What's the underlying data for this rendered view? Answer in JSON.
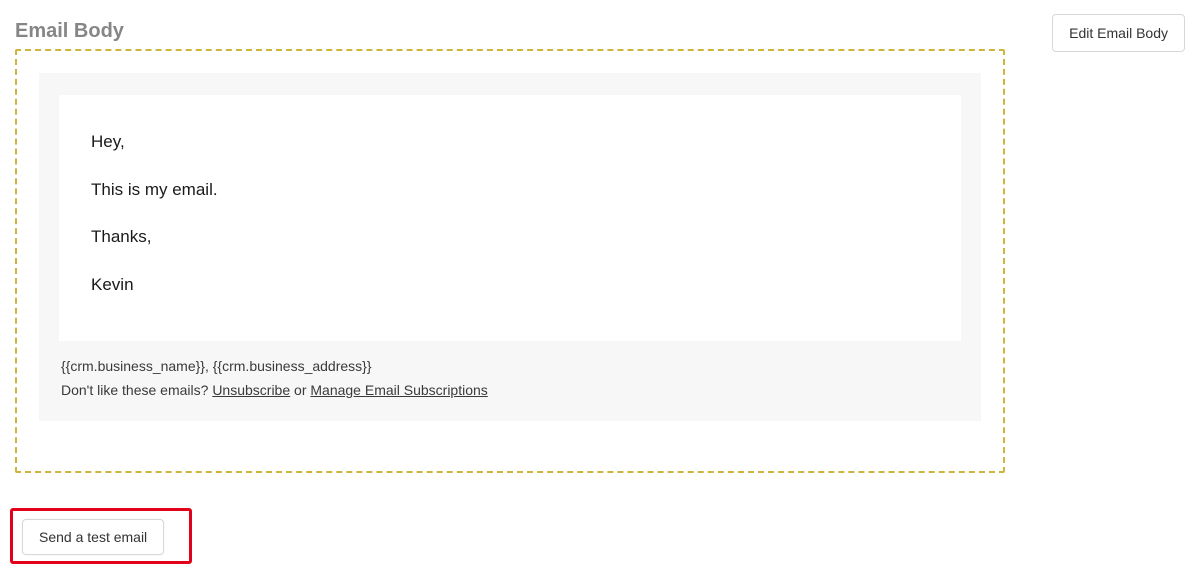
{
  "section": {
    "title": "Email Body"
  },
  "buttons": {
    "edit": "Edit Email Body",
    "sendTest": "Send a test email"
  },
  "email": {
    "greeting": "Hey,",
    "body": "This is my email.",
    "closing": "Thanks,",
    "signature": "Kevin"
  },
  "footer": {
    "placeholders": "{{crm.business_name}}, {{crm.business_address}}",
    "dislikePrefix": "Don't like these emails? ",
    "unsubscribe": "Unsubscribe",
    "or": " or ",
    "manage": "Manage Email Subscriptions"
  }
}
